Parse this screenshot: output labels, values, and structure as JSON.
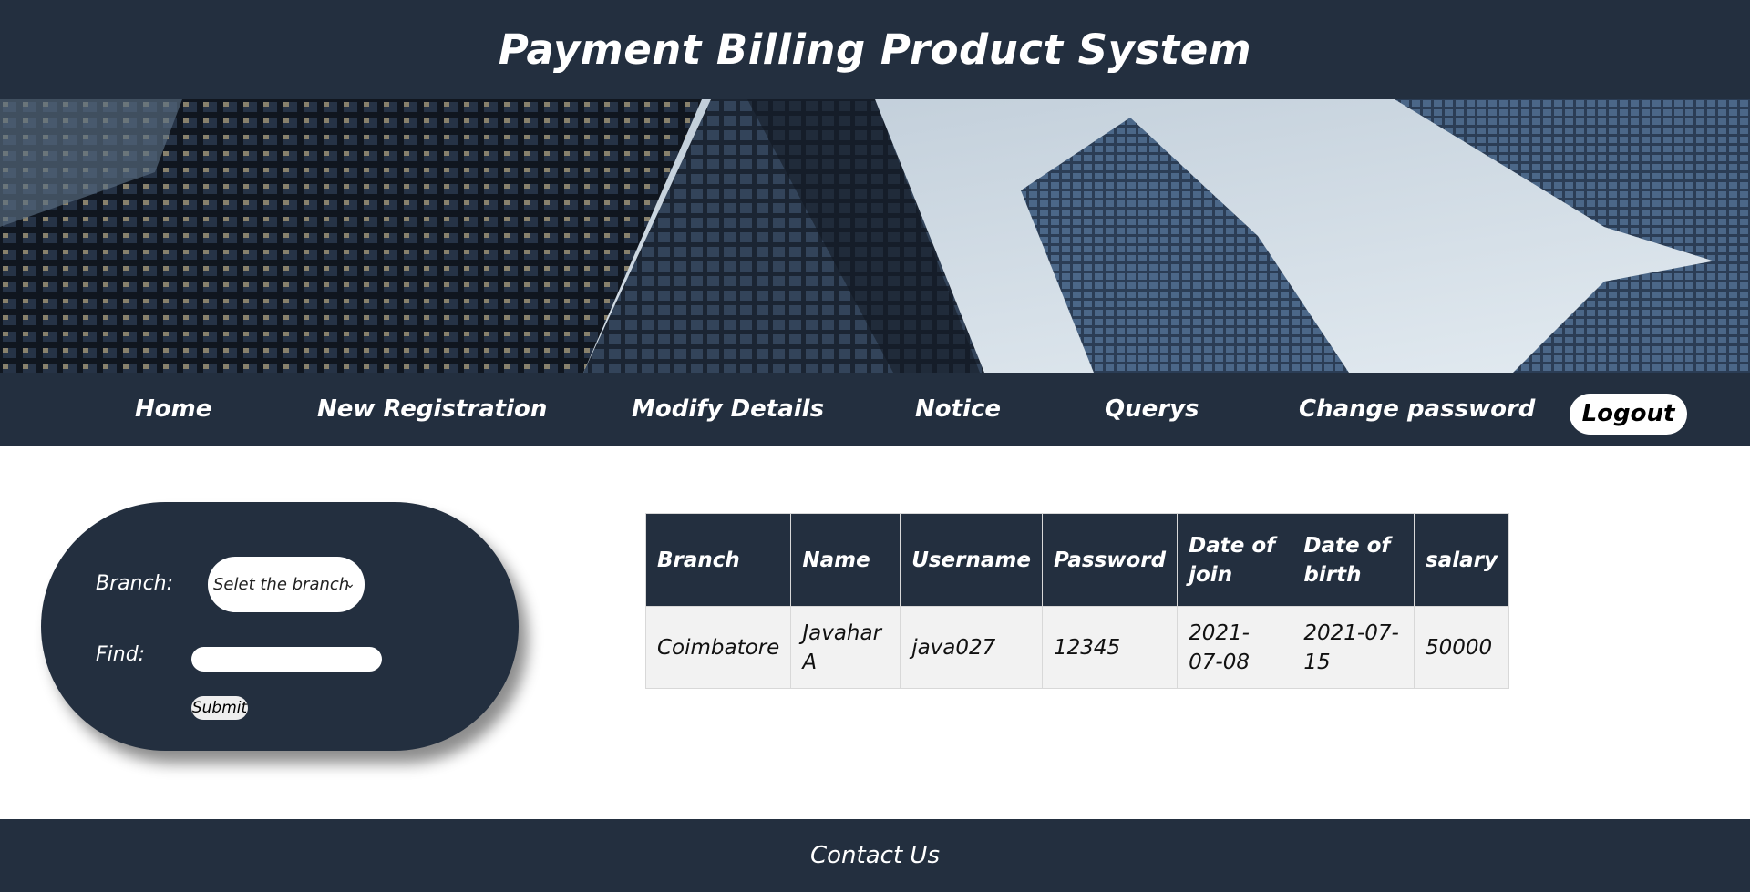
{
  "header": {
    "title": "Payment Billing Product System"
  },
  "nav": {
    "items": [
      "Home",
      "New Registration",
      "Modify Details",
      "Notice",
      "Querys",
      "Change password"
    ],
    "logout": "Logout"
  },
  "search": {
    "branch_label": "Branch:",
    "branch_selected": "Selet the branch",
    "find_label": "Find:",
    "find_value": "",
    "submit_label": "Submit"
  },
  "table": {
    "headers": [
      "Branch",
      "Name",
      "Username",
      "Password",
      "Date of join",
      "Date of birth",
      "salary"
    ],
    "rows": [
      [
        "Coimbatore",
        "Javahar A",
        "java027",
        "12345",
        "2021-07-08",
        "2021-07-15",
        "50000"
      ]
    ]
  },
  "footer": {
    "contact": "Contact Us"
  },
  "colors": {
    "primary": "#232f3f",
    "background": "#ffffff",
    "row": "#f2f2f2"
  }
}
